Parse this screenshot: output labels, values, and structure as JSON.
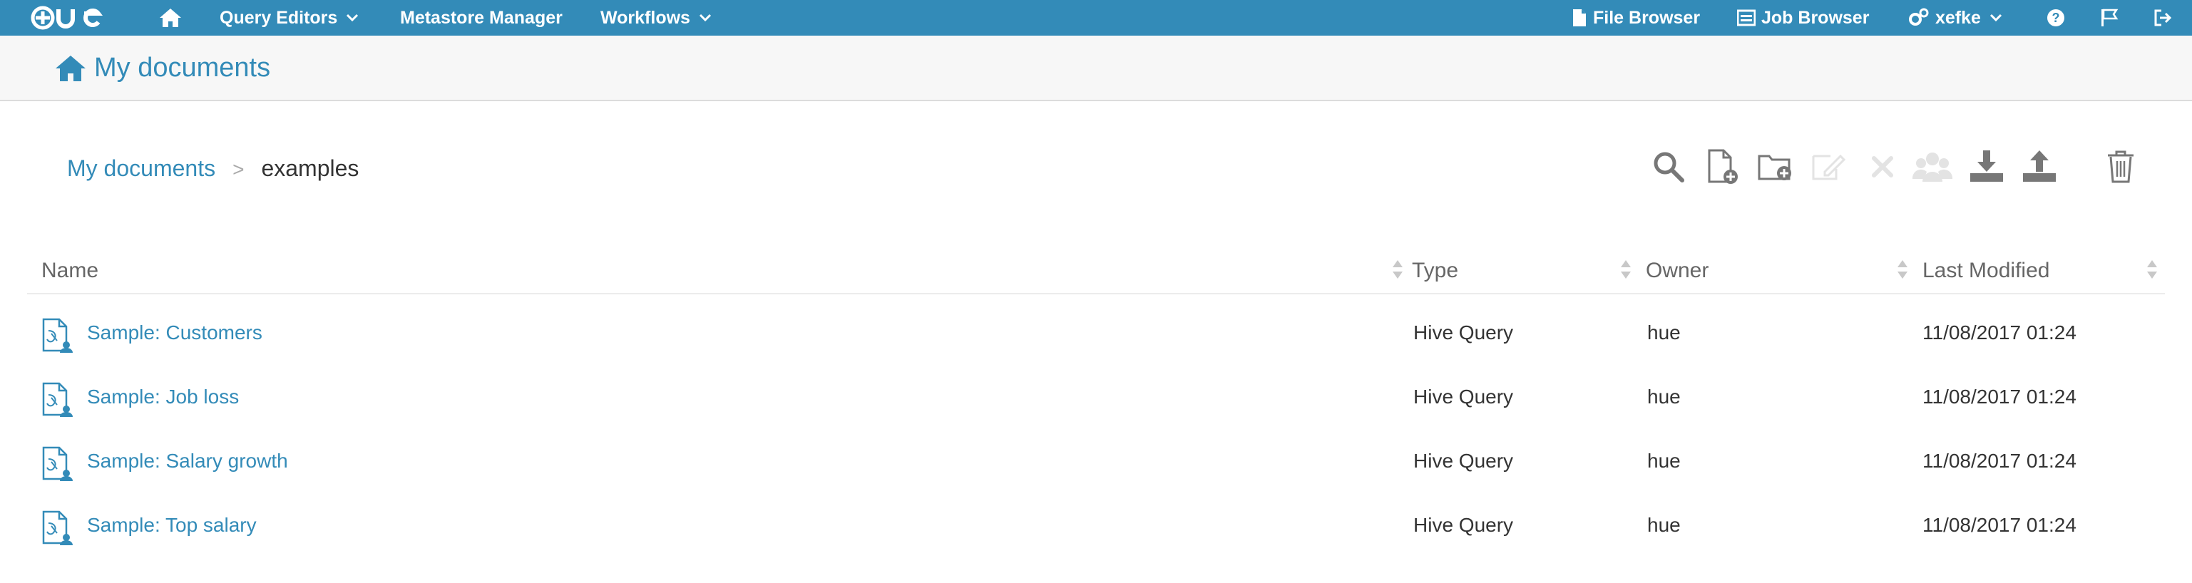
{
  "topnav": {
    "logo_alt": "HUE",
    "query_editors": "Query Editors",
    "metastore": "Metastore Manager",
    "workflows": "Workflows",
    "file_browser": "File Browser",
    "job_browser": "Job Browser",
    "user": "xefke"
  },
  "header": {
    "title": "My documents"
  },
  "breadcrumb": {
    "root": "My documents",
    "separator": ">",
    "current": "examples"
  },
  "toolbar": {
    "icons": [
      "search-icon",
      "new-document-icon",
      "new-folder-icon",
      "edit-icon",
      "delete-x-icon",
      "share-icon",
      "download-icon",
      "upload-icon",
      "trash-icon"
    ]
  },
  "table": {
    "columns": [
      "Name",
      "Type",
      "Owner",
      "Last Modified"
    ],
    "rows": [
      {
        "name": "Sample: Customers",
        "type": "Hive Query",
        "owner": "hue",
        "modified": "11/08/2017 01:24"
      },
      {
        "name": "Sample: Job loss",
        "type": "Hive Query",
        "owner": "hue",
        "modified": "11/08/2017 01:24"
      },
      {
        "name": "Sample: Salary growth",
        "type": "Hive Query",
        "owner": "hue",
        "modified": "11/08/2017 01:24"
      },
      {
        "name": "Sample: Top salary",
        "type": "Hive Query",
        "owner": "hue",
        "modified": "11/08/2017 01:24"
      }
    ]
  },
  "colors": {
    "nav": "#338bb8",
    "link": "#338bb8",
    "header_bg": "#f7f7f7"
  }
}
